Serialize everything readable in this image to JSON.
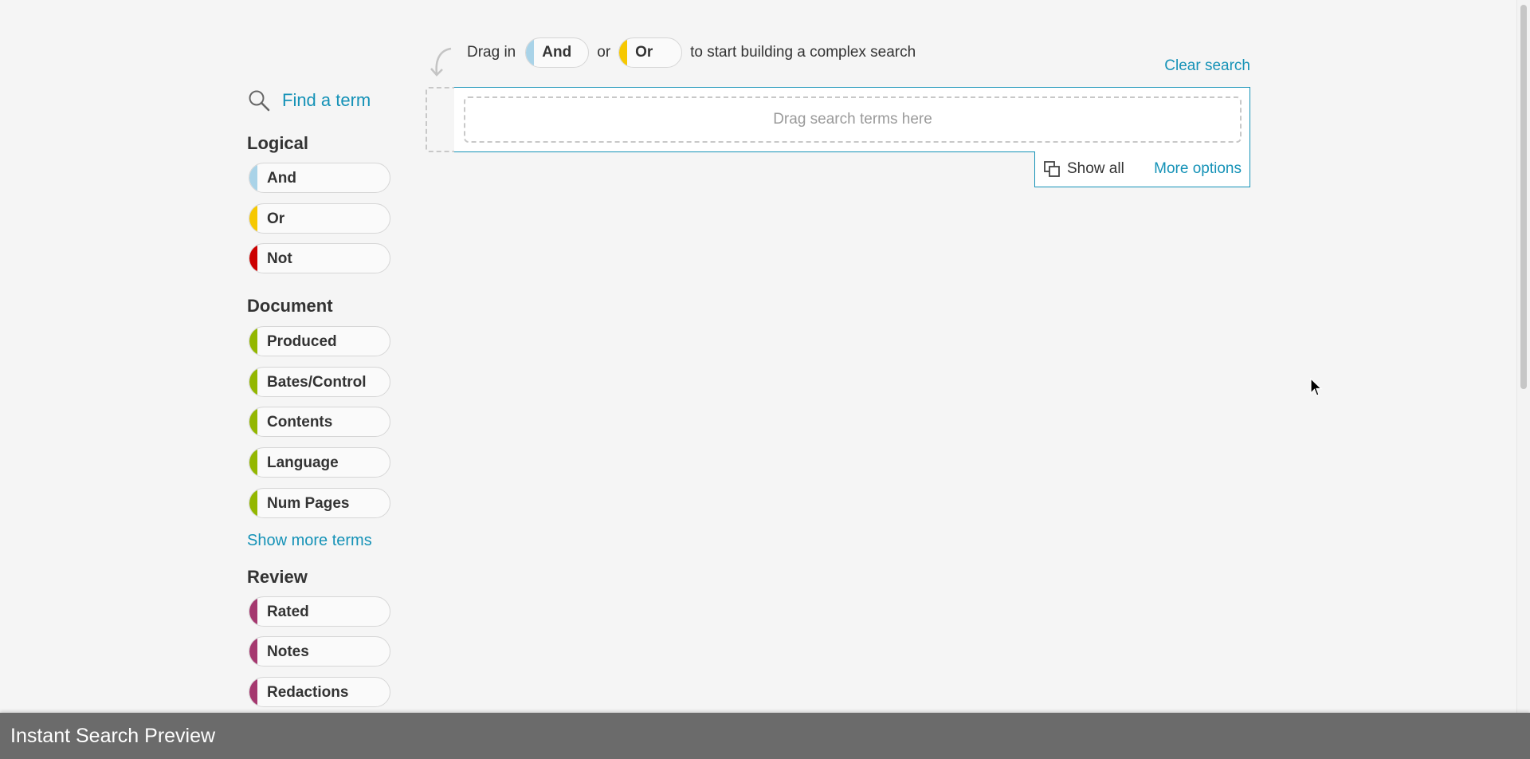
{
  "hint": {
    "drag_in": "Drag in",
    "and_label": "And",
    "or_text": "or",
    "or_label": "Or",
    "suffix": "to start building a complex search"
  },
  "clear_search": "Clear search",
  "search": {
    "drop_placeholder": "Drag search terms here",
    "show_all": "Show all",
    "more_options": "More options"
  },
  "sidebar": {
    "find_term": "Find a term",
    "sections": [
      {
        "title": "Logical",
        "terms": [
          {
            "label": "And",
            "color": "#a9d3e8"
          },
          {
            "label": "Or",
            "color": "#f6c800"
          },
          {
            "label": "Not",
            "color": "#cc0000"
          }
        ]
      },
      {
        "title": "Document",
        "terms": [
          {
            "label": "Produced",
            "color": "#93b700"
          },
          {
            "label": "Bates/Control",
            "color": "#93b700"
          },
          {
            "label": "Contents",
            "color": "#93b700"
          },
          {
            "label": "Language",
            "color": "#93b700"
          },
          {
            "label": "Num Pages",
            "color": "#93b700"
          }
        ],
        "show_more": "Show more terms"
      },
      {
        "title": "Review",
        "terms": [
          {
            "label": "Rated",
            "color": "#a5386f"
          },
          {
            "label": "Notes",
            "color": "#a5386f"
          },
          {
            "label": "Redactions",
            "color": "#a5386f"
          }
        ]
      }
    ]
  },
  "footer": {
    "title": "Instant Search Preview"
  },
  "colors": {
    "accent": "#1592b7",
    "footer_bg": "#6b6b6b"
  },
  "icons": {
    "find": "search-icon",
    "show_all": "copy-icon",
    "hint": "curved-arrow-icon"
  }
}
